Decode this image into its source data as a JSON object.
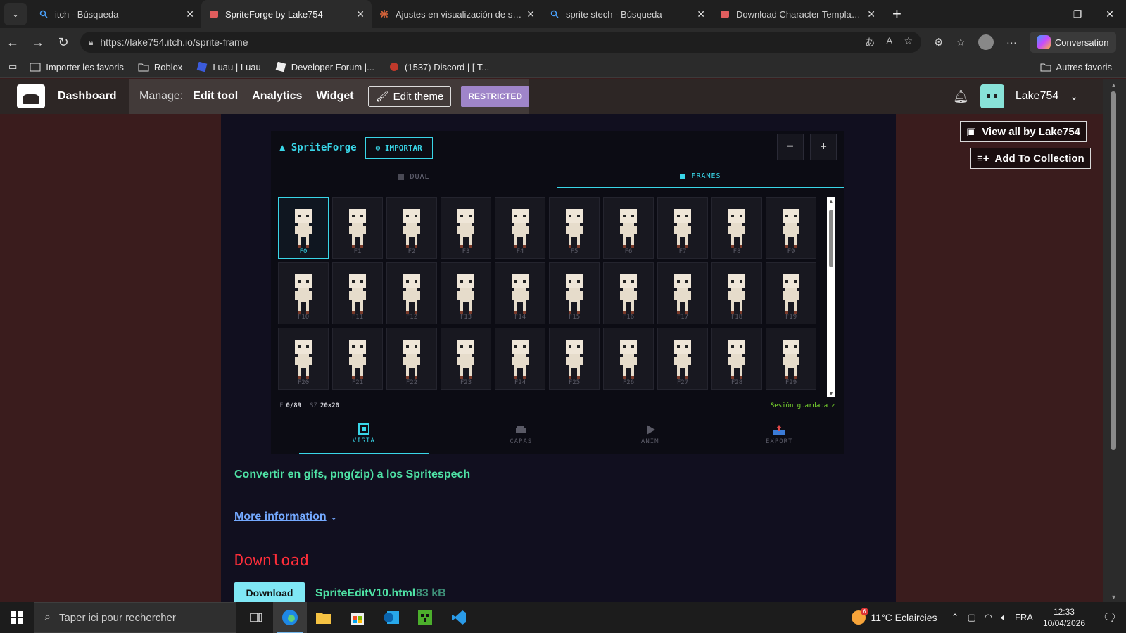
{
  "browser": {
    "tabs": [
      {
        "title": "itch - Búsqueda",
        "icon": "search-icon"
      },
      {
        "title": "SpriteForge by Lake754",
        "icon": "itch-icon"
      },
      {
        "title": "Ajustes en visualización de sprites",
        "icon": "ai-icon"
      },
      {
        "title": "sprite stech - Búsqueda",
        "icon": "search-icon"
      },
      {
        "title": "Download Character Templates Pa",
        "icon": "itch-icon"
      }
    ],
    "url": "https://lake754.itch.io/sprite-frame",
    "copilot_label": "Conversation",
    "bookmarks": [
      "Importer les favoris",
      "Roblox",
      "Luau | Luau",
      "Developer Forum |...",
      "(1537) Discord | [ T..."
    ],
    "other_favorites": "Autres favoris"
  },
  "itch": {
    "dashboard": "Dashboard",
    "manage_label": "Manage:",
    "links": [
      "Edit tool",
      "Analytics",
      "Widget"
    ],
    "edit_theme": "Edit theme",
    "restricted": "RESTRICTED",
    "username": "Lake754",
    "view_all": "View all by Lake754",
    "add_collection": "Add To Collection"
  },
  "app": {
    "name": "▲ SpriteForge",
    "import_btn": "⊕ IMPORTAR",
    "zoom_out": "−",
    "zoom_in": "+",
    "mode_tabs": [
      "DUAL",
      "FRAMES"
    ],
    "active_mode": "FRAMES",
    "frames": [
      "F0",
      "F1",
      "F2",
      "F3",
      "F4",
      "F5",
      "F6",
      "F7",
      "F8",
      "F9",
      "F10",
      "F11",
      "F12",
      "F13",
      "F14",
      "F15",
      "F16",
      "F17",
      "F18",
      "F19",
      "F20",
      "F21",
      "F22",
      "F23",
      "F24",
      "F25",
      "F26",
      "F27",
      "F28",
      "F29"
    ],
    "selected_frame": "F0",
    "status": {
      "frame_label": "F",
      "frame_value": "0/89",
      "size_label": "SZ",
      "size_value": "20×20",
      "saved": "Sesión guardada ✓"
    },
    "bottom_nav": [
      "VISTA",
      "CAPAS",
      "ANIM",
      "EXPORT"
    ],
    "active_nav": "VISTA"
  },
  "page": {
    "description": "Convertir en gifs,  png(zip) a los Spritespech",
    "more_info": "More information",
    "download_heading": "Download",
    "download_button": "Download",
    "file_name": "SpriteEditV10.html",
    "file_size": "83 kB"
  },
  "taskbar": {
    "search_placeholder": "Taper ici pour rechercher",
    "weather": "11°C  Eclaircies",
    "weather_badge": "6",
    "lang": "FRA",
    "time": "12:33",
    "date": "10/04/2026",
    "notif_count": "1"
  },
  "colors": {
    "accent": "#39d6e8",
    "desc_green": "#4fe3a6",
    "download_red": "#ff2e3a",
    "restricted_purple": "#9f85c9",
    "page_bg": "#3a1c1d",
    "content_bg": "#110f1f"
  }
}
